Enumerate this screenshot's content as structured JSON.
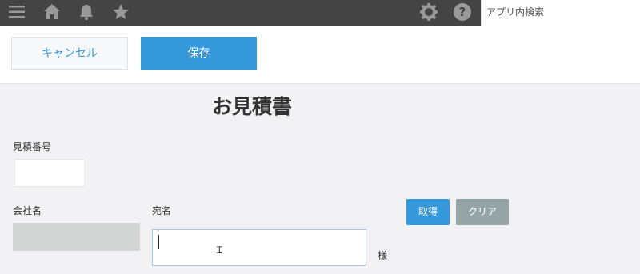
{
  "header": {
    "icons": [
      "menu-icon",
      "home-icon",
      "bell-icon",
      "star-icon",
      "gear-icon",
      "help-icon"
    ],
    "search_placeholder": "アプリ内検索"
  },
  "toolbar": {
    "cancel_label": "キャンセル",
    "save_label": "保存"
  },
  "form": {
    "title": "お見積書",
    "estimate_number_label": "見積番号",
    "estimate_number_value": "",
    "company_label": "会社名",
    "company_value": "",
    "recipient_label": "宛名",
    "recipient_value": "",
    "honorific": "様",
    "get_label": "取得",
    "clear_label": "クリア"
  },
  "colors": {
    "topbar": "#444444",
    "accent": "#3498db",
    "clear_button": "#95a5a6"
  }
}
